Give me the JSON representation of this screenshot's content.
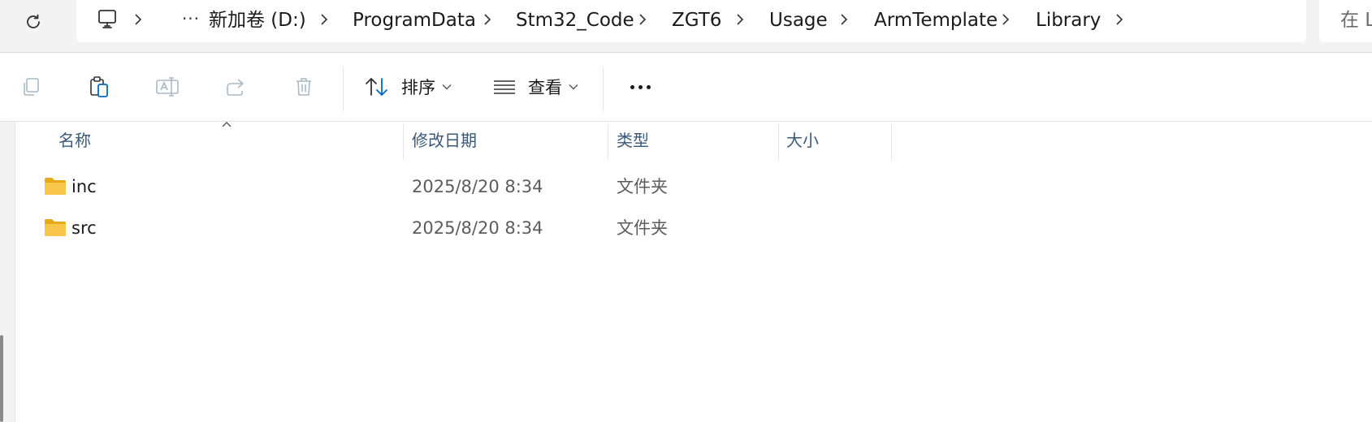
{
  "address_bar": {
    "overflow_label": "···",
    "breadcrumbs": [
      "新加卷 (D:)",
      "ProgramData",
      "Stm32_Code",
      "ZGT6",
      "Usage",
      "ArmTemplate",
      "Library"
    ],
    "search_placeholder": "在 L"
  },
  "toolbar": {
    "copy_icon": "copy-icon",
    "paste_icon": "paste-icon",
    "rename_icon": "rename-icon",
    "share_icon": "share-icon",
    "delete_icon": "delete-icon",
    "sort_label": "排序",
    "view_label": "查看",
    "more_icon": "more-icon"
  },
  "columns": {
    "name": "名称",
    "modified": "修改日期",
    "type": "类型",
    "size": "大小"
  },
  "files": [
    {
      "name": "inc",
      "modified": "2025/8/20 8:34",
      "type": "文件夹",
      "size": ""
    },
    {
      "name": "src",
      "modified": "2025/8/20 8:34",
      "type": "文件夹",
      "size": ""
    }
  ],
  "colors": {
    "accent": "#0067c0",
    "folder": "#f7c64a",
    "header_text": "#3a5a7a",
    "disabled_icon": "#a9b9c6"
  }
}
